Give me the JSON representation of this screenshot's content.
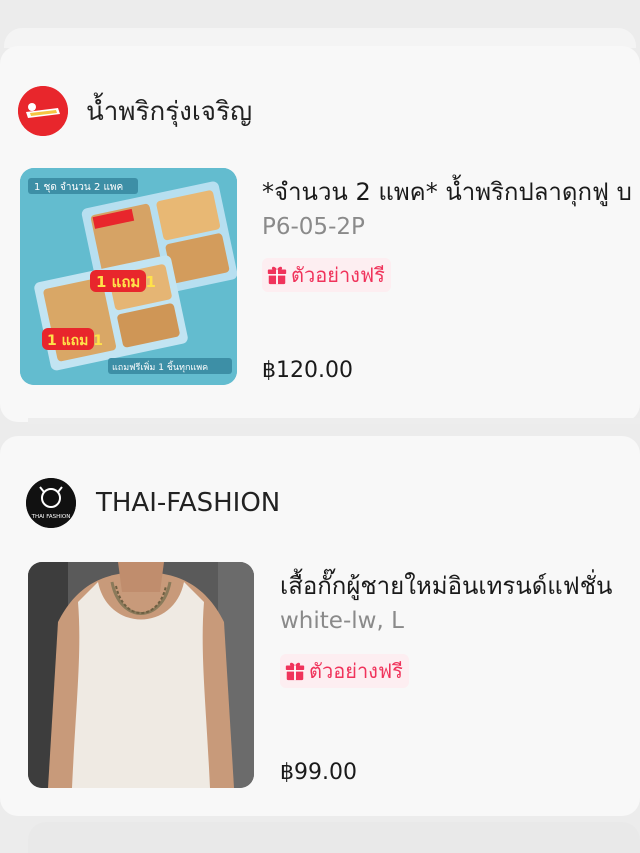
{
  "orders": [
    {
      "shop_name": "น้ำพริกรุ่งเจริญ",
      "product_title": "*จำนวน 2 แพค* น้ำพริกปลาดุกฟู บ",
      "variant": "P6-05-2P",
      "badge_label": "ตัวอย่างฟรี",
      "price": "฿120.00",
      "image_texts": [
        "1 ชุด จำนวน 2 แพค",
        "1 แถม 1",
        "1 แถม 1",
        "แถมฟรีเพิ่ม 1 ชิ้นทุกแพค"
      ]
    },
    {
      "shop_name": "THAI-FASHION",
      "product_title": "เสื้อกั๊กผู้ชายใหม่อินเทรนด์แฟชั่น",
      "variant": "white-lw, L",
      "badge_label": "ตัวอย่างฟรี",
      "price": "฿99.00",
      "avatar_text": "THAI FASHION"
    }
  ],
  "colors": {
    "badge_text": "#f0335b",
    "badge_bg": "#fdeef1",
    "shop1_avatar": "#e8262c",
    "shop2_avatar": "#111111"
  },
  "icons": [
    "gift-icon",
    "shop-logo",
    "product-image"
  ]
}
